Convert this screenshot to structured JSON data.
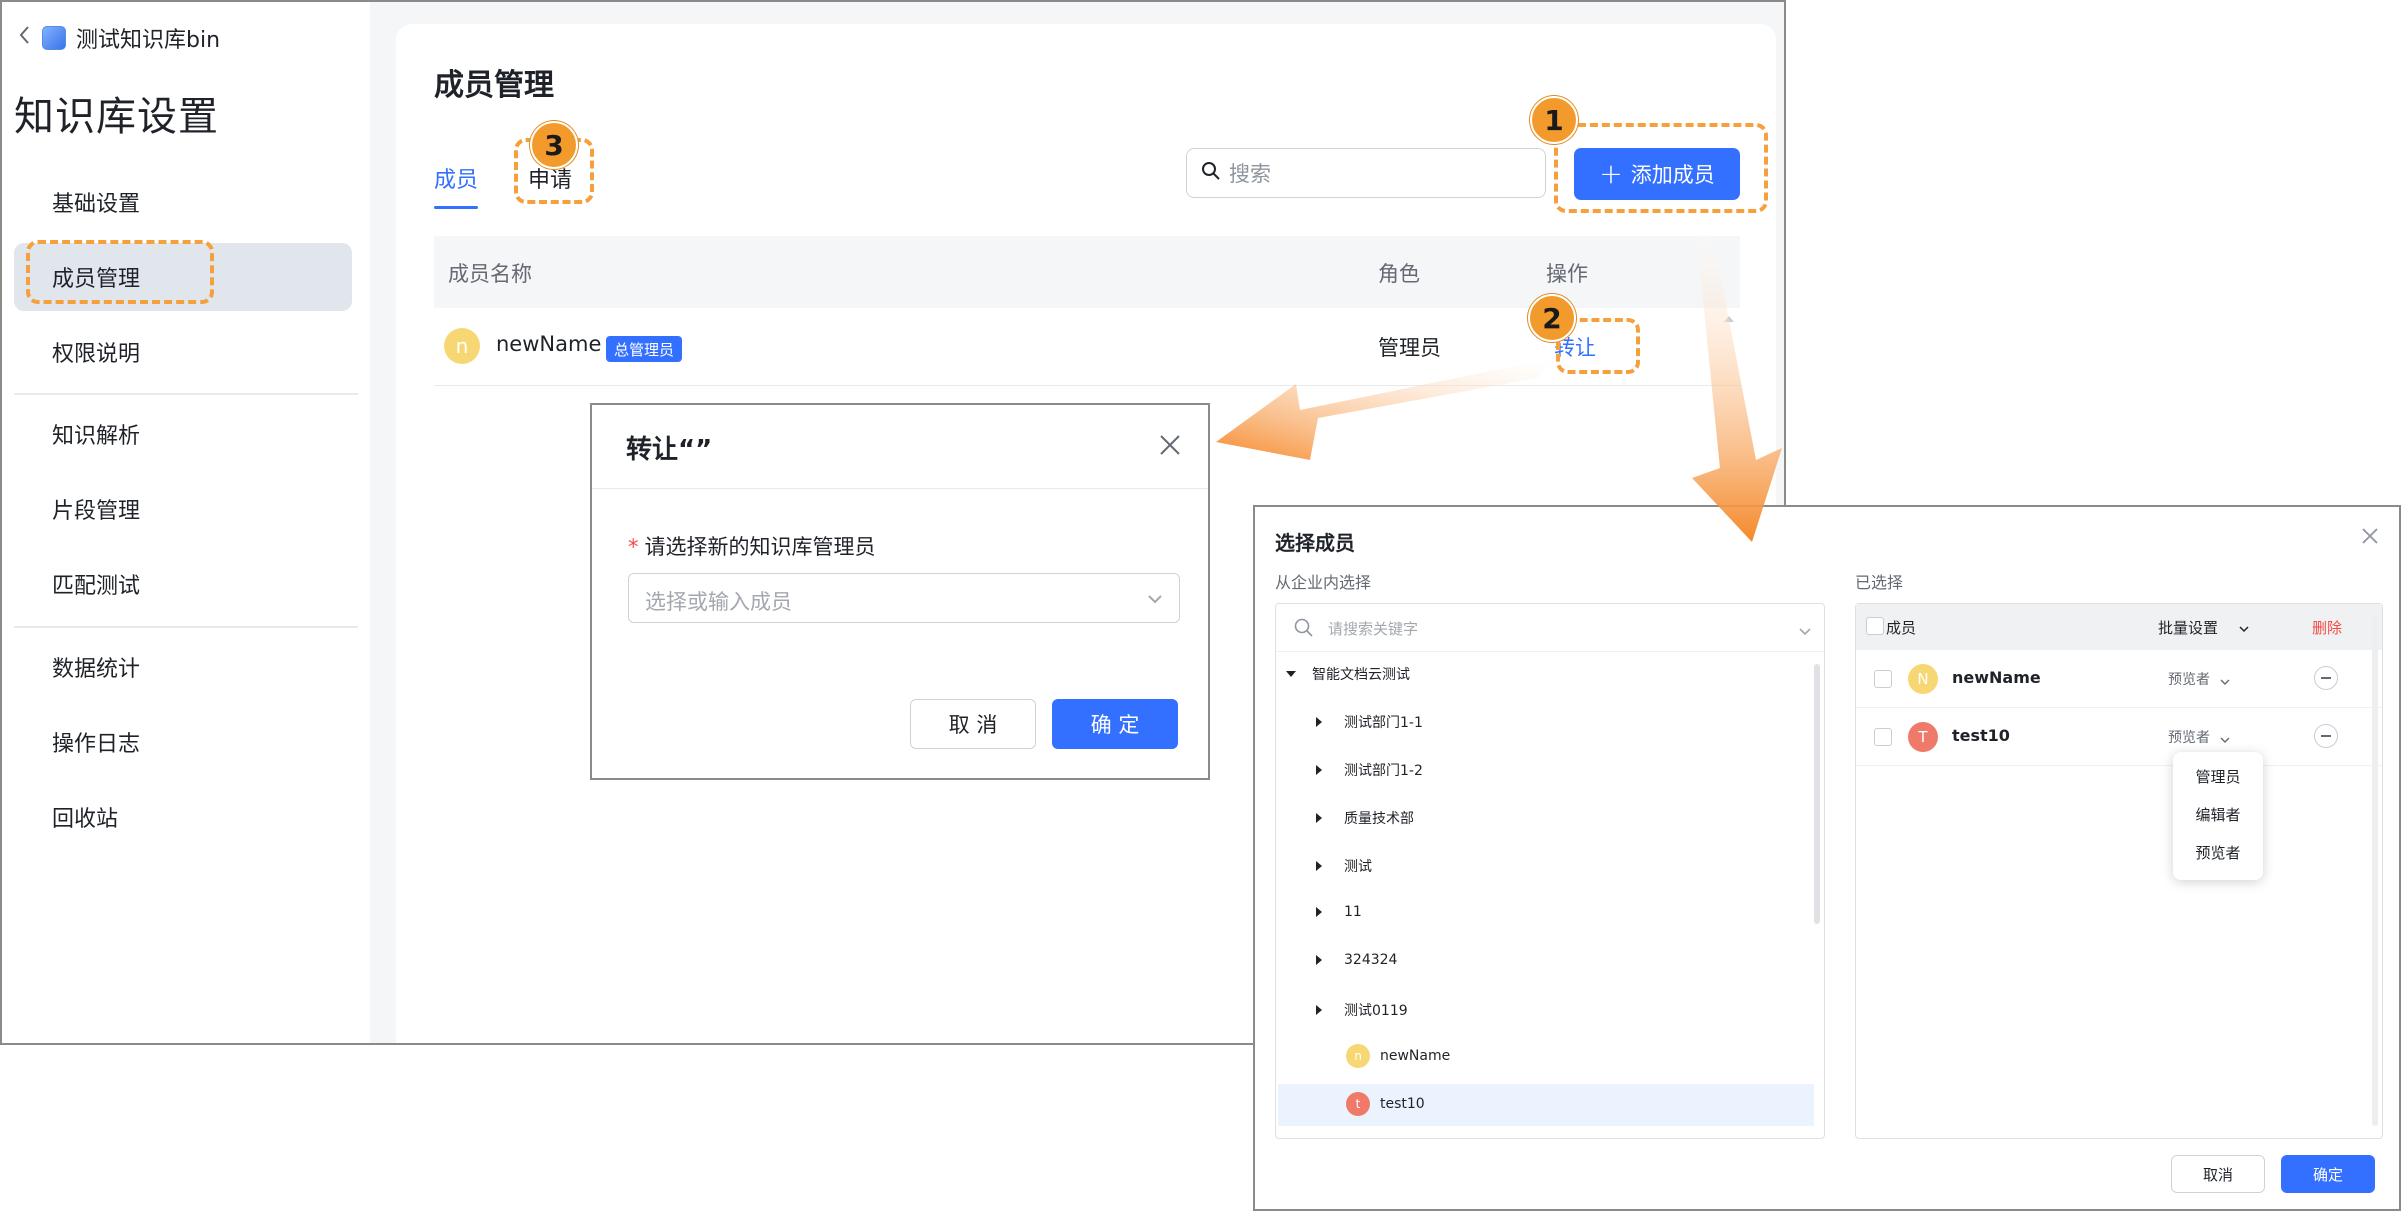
{
  "sidebar": {
    "kb_name": "测试知识库bin",
    "title": "知识库设置",
    "items": [
      {
        "label": "基础设置"
      },
      {
        "label": "成员管理"
      },
      {
        "label": "权限说明"
      },
      {
        "label": "知识解析"
      },
      {
        "label": "片段管理"
      },
      {
        "label": "匹配测试"
      },
      {
        "label": "数据统计"
      },
      {
        "label": "操作日志"
      },
      {
        "label": "回收站"
      }
    ]
  },
  "main": {
    "title": "成员管理",
    "tabs": [
      {
        "label": "成员"
      },
      {
        "label": "申请"
      }
    ],
    "search_placeholder": "搜索",
    "add_button": "添加成员",
    "columns": {
      "name": "成员名称",
      "role": "角色",
      "action": "操作"
    },
    "rows": [
      {
        "avatar": "n",
        "name": "newName",
        "badge": "总管理员",
        "role": "管理员",
        "action": "转让"
      }
    ]
  },
  "transfer_dialog": {
    "title": "转让“”",
    "field_label": "请选择新的知识库管理员",
    "placeholder": "选择或输入成员",
    "cancel": "取 消",
    "confirm": "确 定"
  },
  "select_dialog": {
    "title": "选择成员",
    "left_label": "从企业内选择",
    "right_label": "已选择",
    "search_placeholder": "请搜索关键字",
    "tree": {
      "root": "智能文档云测试",
      "children": [
        "测试部门1-1",
        "测试部门1-2",
        "质量技术部",
        "测试",
        "11",
        "324324",
        "测试0119"
      ],
      "members": [
        {
          "avatar": "n",
          "name": "newName"
        },
        {
          "avatar": "t",
          "name": "test10"
        }
      ]
    },
    "selected_header": {
      "member": "成员",
      "batch": "批量设置",
      "delete": "删除"
    },
    "selected": [
      {
        "avatar": "N",
        "name": "newName",
        "role": "预览者"
      },
      {
        "avatar": "T",
        "name": "test10",
        "role": "预览者"
      }
    ],
    "role_menu": [
      "管理员",
      "编辑者",
      "预览者"
    ],
    "cancel": "取消",
    "confirm": "确定"
  },
  "annotations": [
    "1",
    "2",
    "3"
  ],
  "colors": {
    "accent": "#3370ff",
    "annotation": "#f29b2c",
    "danger": "#f54a45"
  }
}
